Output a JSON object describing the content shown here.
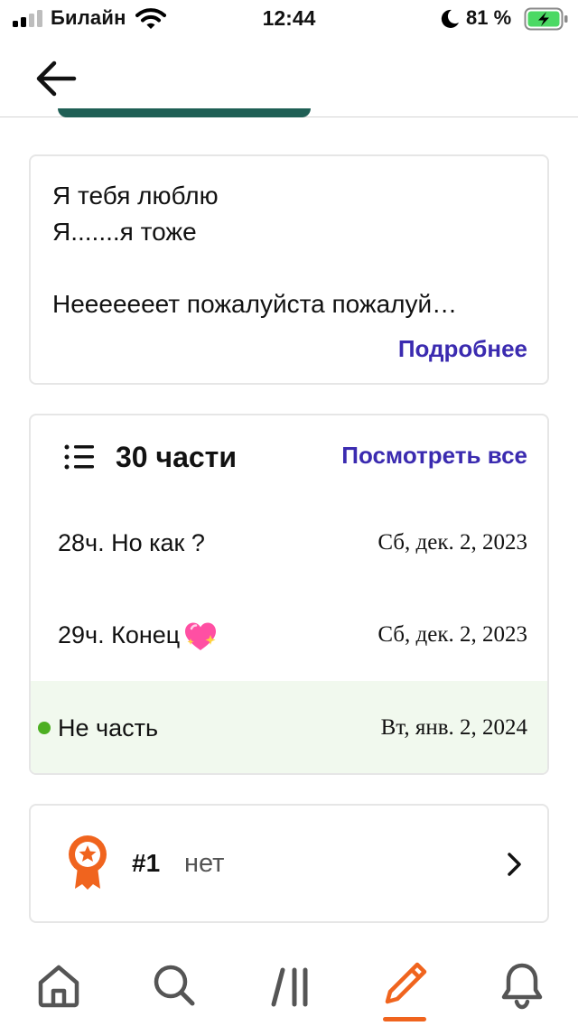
{
  "status_bar": {
    "carrier": "Билайн",
    "time": "12:44",
    "battery_percent": "81 %"
  },
  "header": {
    "back_icon": "arrow-left-icon"
  },
  "description": {
    "line1": "Я тебя люблю",
    "line2": "Я.......я тоже",
    "line3": "Нееееееет пожалуйста пожалуй…",
    "more_label": "Подробнее"
  },
  "parts": {
    "title": "30 части",
    "view_all_label": "Посмотреть все",
    "items": [
      {
        "title": "28ч. Но как ?",
        "date": "Сб, дек. 2, 2023"
      },
      {
        "title": "29ч. Конец",
        "emoji": "sparkling-heart-icon",
        "date": "Сб, дек. 2, 2023"
      },
      {
        "title": "Не часть",
        "date": "Вт, янв. 2, 2024",
        "current": true
      }
    ]
  },
  "ranking": {
    "rank": "#1",
    "tag": "нет"
  },
  "bottom_nav": {
    "items": [
      "home-icon",
      "search-icon",
      "library-icon",
      "pencil-icon",
      "bell-icon"
    ],
    "active": "pencil-icon"
  },
  "colors": {
    "accent_link": "#3b2bb0",
    "brand_orange": "#f0641e",
    "current_dot": "#4caf21",
    "current_row_bg": "#f1f9ee"
  }
}
